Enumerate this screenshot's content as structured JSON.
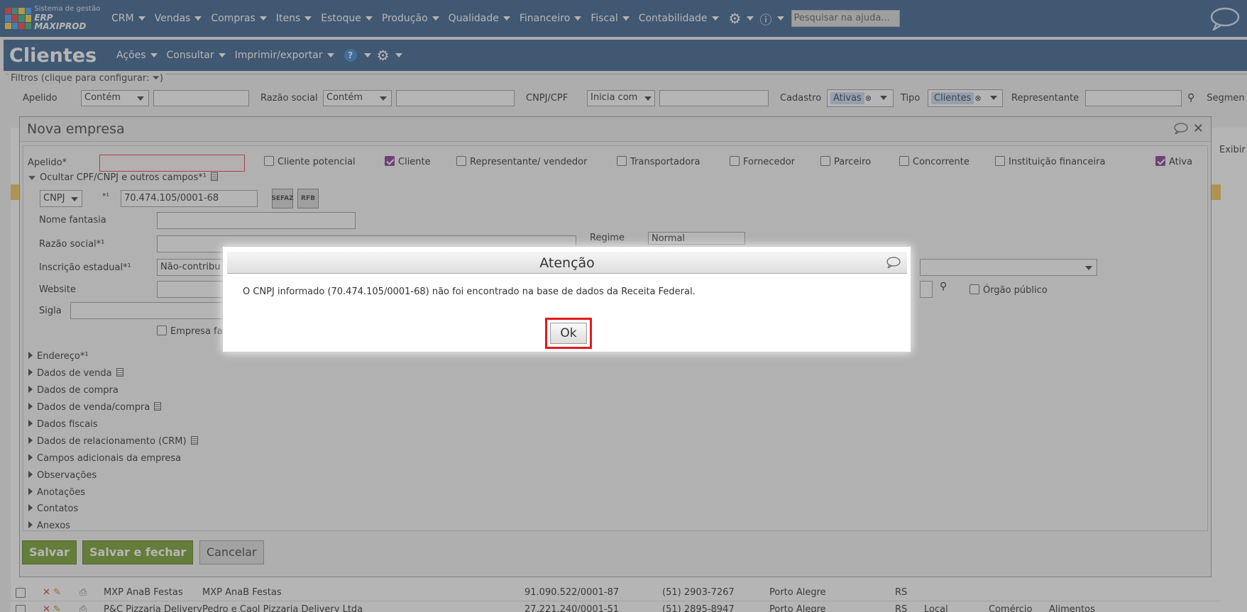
{
  "brand": {
    "line1": "Sistema de gestão",
    "line2": "ERP MAXIPROD"
  },
  "topnav": {
    "items": [
      "CRM",
      "Vendas",
      "Compras",
      "Itens",
      "Estoque",
      "Produção",
      "Qualidade",
      "Financeiro",
      "Fiscal",
      "Contabilidade"
    ],
    "help_placeholder": "Pesquisar na ajuda..."
  },
  "page": {
    "title": "Clientes",
    "menu": [
      "Ações",
      "Consultar",
      "Imprimir/exportar"
    ]
  },
  "filters": {
    "legend": "Filtros (clique para configurar:",
    "legend_end": ")",
    "apelido_label": "Apelido",
    "apelido_op": "Contém",
    "razao_label": "Razão social",
    "razao_op": "Contém",
    "cnpj_label": "CNPJ/CPF",
    "cnpj_op": "Inicia com",
    "cadastro_label": "Cadastro",
    "cadastro_tag": "Ativas",
    "tipo_label": "Tipo",
    "tipo_tag": "Clientes",
    "representante_label": "Representante",
    "segmento_label": "Segmen",
    "exibir_label": "Exibir"
  },
  "bg_rows": [
    {
      "apelido": "MXP AnaB Festas",
      "razao": "MXP AnaB Festas",
      "cnpj": "91.090.522/0001-87",
      "fone": "(51) 2903-7267",
      "cidade": "Porto Alegre",
      "uf": "RS",
      "c1": "",
      "c2": "",
      "c3": ""
    },
    {
      "apelido": "P&C Pizzaria Delivery",
      "razao": "Pedro e Caol Pizzaria Delivery Ltda",
      "cnpj": "27.221.240/0001-51",
      "fone": "(51) 2895-8947",
      "cidade": "Porto Alegre",
      "uf": "RS",
      "c1": "Local",
      "c2": "Comércio",
      "c3": "Alimentos"
    }
  ],
  "dialog": {
    "title": "Nova empresa",
    "apelido_label": "Apelido*",
    "checkboxes": [
      {
        "label": "Cliente potencial",
        "checked": false
      },
      {
        "label": "Cliente",
        "checked": true
      },
      {
        "label": "Representante/ vendedor",
        "checked": false
      },
      {
        "label": "Transportadora",
        "checked": false
      },
      {
        "label": "Fornecedor",
        "checked": false
      },
      {
        "label": "Parceiro",
        "checked": false
      },
      {
        "label": "Concorrente",
        "checked": false
      },
      {
        "label": "Instituição financeira",
        "checked": false
      },
      {
        "label": "Ativa",
        "checked": true
      }
    ],
    "ocultar_label": "Ocultar CPF/CNPJ e outros campos*¹",
    "doc_type": "CNPJ",
    "doc_marker": "*¹",
    "doc_value": "70.474.105/0001-68",
    "sefaz_label": "SEFAZ",
    "rfb_label": "RFB",
    "nome_fantasia_label": "Nome fantasia",
    "razao_social_label": "Razão social*¹",
    "regime_label": "Regime",
    "regime_value": "Normal",
    "inscricao_label": "Inscrição estadual*¹",
    "inscricao_value": "Não-contribu",
    "website_label": "Website",
    "orgao_publico_label": "Órgão público",
    "sigla_label": "Sigla",
    "empresa_fa_label": "Empresa fa",
    "sections": [
      {
        "label": "Endereço*¹",
        "doc": false
      },
      {
        "label": "Dados de venda",
        "doc": true
      },
      {
        "label": "Dados de compra",
        "doc": false
      },
      {
        "label": "Dados de venda/compra",
        "doc": true
      },
      {
        "label": "Dados fiscais",
        "doc": false
      },
      {
        "label": "Dados de relacionamento (CRM)",
        "doc": true
      },
      {
        "label": "Campos adicionais da empresa",
        "doc": false
      },
      {
        "label": "Observações",
        "doc": false
      },
      {
        "label": "Anotações",
        "doc": false
      },
      {
        "label": "Contatos",
        "doc": false
      },
      {
        "label": "Anexos",
        "doc": false
      }
    ],
    "save_label": "Salvar",
    "save_close_label": "Salvar e fechar",
    "cancel_label": "Cancelar"
  },
  "alert": {
    "title": "Atenção",
    "message": "O CNPJ informado (70.474.105/0001-68) não foi encontrado na base de dados da Receita Federal.",
    "ok_label": "Ok"
  },
  "colors": {
    "navbar": "#2a5686",
    "accent_green": "#6c9a1f",
    "check_purple": "#7b2e8f",
    "highlight_red": "#e21a1a"
  }
}
